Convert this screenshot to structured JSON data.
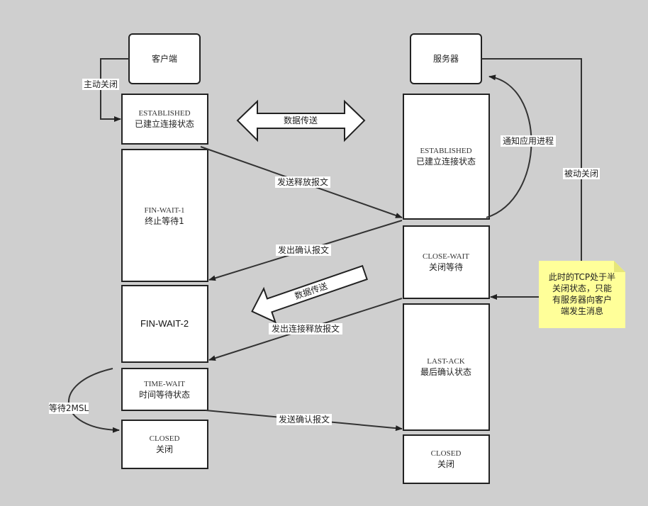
{
  "client": {
    "title": "客户端"
  },
  "server": {
    "title": "服务器"
  },
  "client_states": [
    {
      "en": "ESTABLISHED",
      "zh": "已建立连接状态"
    },
    {
      "en": "FIN-WAIT-1",
      "zh": "终止等待1"
    },
    {
      "en": "FIN-WAIT-2",
      "zh": ""
    },
    {
      "en": "TIME-WAIT",
      "zh": "时间等待状态"
    },
    {
      "en": "CLOSED",
      "zh": "关闭"
    }
  ],
  "server_states": [
    {
      "en": "ESTABLISHED",
      "zh": "已建立连接状态"
    },
    {
      "en": "CLOSE-WAIT",
      "zh": "关闭等待"
    },
    {
      "en": "LAST-ACK",
      "zh": "最后确认状态"
    },
    {
      "en": "CLOSED",
      "zh": "关闭"
    }
  ],
  "labels": {
    "active_close": "主动关闭",
    "data_transfer": "数据传送",
    "send_release": "发送释放报文",
    "send_ack": "发出确认报文",
    "data_transfer_half": "数据传送",
    "send_conn_release": "发出连接释放报文",
    "send_confirm": "发送确认报文",
    "wait_2msl": "等待2MSL",
    "notify_app": "通知应用进程",
    "passive_close": "被动关闭"
  },
  "note": {
    "lines": [
      "此时的TCP处于半",
      "关闭状态，只能",
      "有服务器向客户",
      "端发生消息"
    ],
    "color": "#ffff99"
  }
}
